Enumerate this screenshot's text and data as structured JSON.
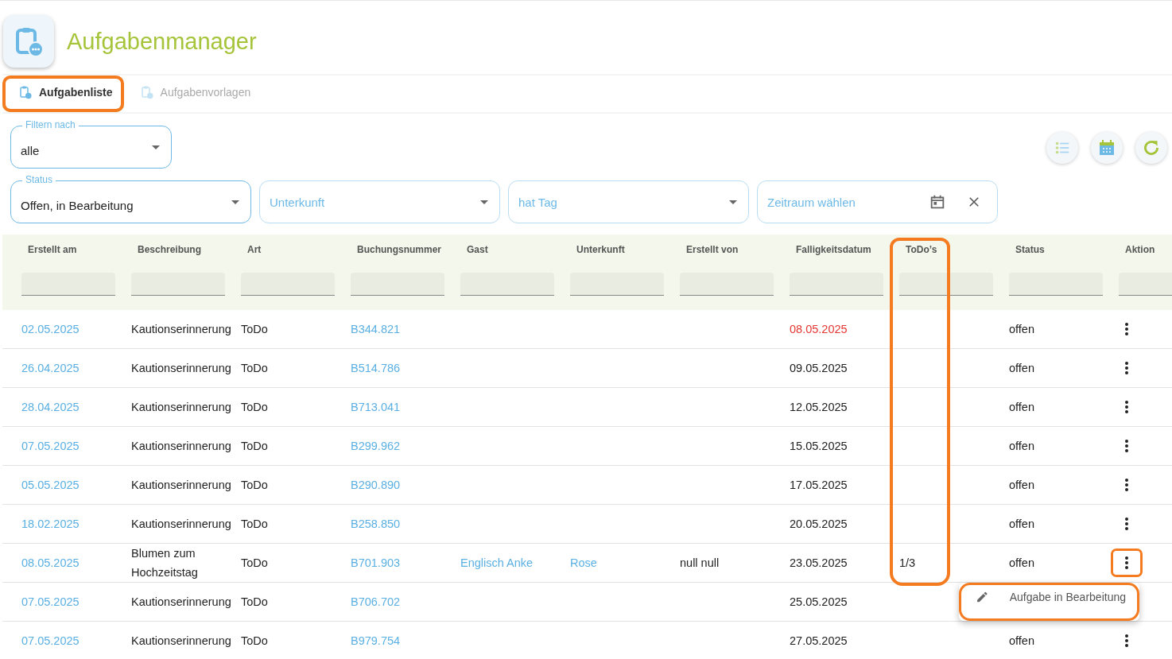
{
  "app": {
    "title": "Aufgabenmanager"
  },
  "tabs": [
    {
      "label": "Aufgabenliste",
      "selected": true,
      "highlighted": true
    },
    {
      "label": "Aufgabenvorlagen",
      "selected": false,
      "highlighted": false
    }
  ],
  "filter_by": {
    "label": "Filtern nach",
    "value": "alle"
  },
  "filters": [
    {
      "kind": "select",
      "label": "Status",
      "value": "Offen, in Bearbeitung"
    },
    {
      "kind": "select",
      "placeholder": "Unterkunft"
    },
    {
      "kind": "select",
      "placeholder": "hat Tag"
    },
    {
      "kind": "date",
      "placeholder": "Zeitraum wählen"
    }
  ],
  "table": {
    "columns": [
      "Erstellt am",
      "Beschreibung",
      "Art",
      "Buchungsnummer",
      "Gast",
      "Unterkunft",
      "Erstellt von",
      "Falligkeitsdatum",
      "ToDo’s",
      "Status",
      "Aktion"
    ],
    "rows": [
      {
        "created": "02.05.2025",
        "description": "Kautionserinnerung",
        "type": "ToDo",
        "booking": "B344.821",
        "guest": "",
        "accommodation": "",
        "created_by": "",
        "due": "08.05.2025",
        "overdue": true,
        "todos": "",
        "status": "offen",
        "action_highlighted": false
      },
      {
        "created": "26.04.2025",
        "description": "Kautionserinnerung",
        "type": "ToDo",
        "booking": "B514.786",
        "guest": "",
        "accommodation": "",
        "created_by": "",
        "due": "09.05.2025",
        "overdue": false,
        "todos": "",
        "status": "offen",
        "action_highlighted": false
      },
      {
        "created": "28.04.2025",
        "description": "Kautionserinnerung",
        "type": "ToDo",
        "booking": "B713.041",
        "guest": "",
        "accommodation": "",
        "created_by": "",
        "due": "12.05.2025",
        "overdue": false,
        "todos": "",
        "status": "offen",
        "action_highlighted": false
      },
      {
        "created": "07.05.2025",
        "description": "Kautionserinnerung",
        "type": "ToDo",
        "booking": "B299.962",
        "guest": "",
        "accommodation": "",
        "created_by": "",
        "due": "15.05.2025",
        "overdue": false,
        "todos": "",
        "status": "offen",
        "action_highlighted": false
      },
      {
        "created": "05.05.2025",
        "description": "Kautionserinnerung",
        "type": "ToDo",
        "booking": "B290.890",
        "guest": "",
        "accommodation": "",
        "created_by": "",
        "due": "17.05.2025",
        "overdue": false,
        "todos": "",
        "status": "offen",
        "action_highlighted": false
      },
      {
        "created": "18.02.2025",
        "description": "Kautionserinnerung",
        "type": "ToDo",
        "booking": "B258.850",
        "guest": "",
        "accommodation": "",
        "created_by": "",
        "due": "20.05.2025",
        "overdue": false,
        "todos": "",
        "status": "offen",
        "action_highlighted": false
      },
      {
        "created": "08.05.2025",
        "description": "Blumen zum Hochzeitstag",
        "type": "ToDo",
        "booking": "B701.903",
        "guest": "Englisch Anke",
        "accommodation": "Rose",
        "created_by": "null null",
        "due": "23.05.2025",
        "overdue": false,
        "todos": "1/3",
        "status": "offen",
        "action_highlighted": true
      },
      {
        "created": "07.05.2025",
        "description": "Kautionserinnerung",
        "type": "ToDo",
        "booking": "B706.702",
        "guest": "",
        "accommodation": "",
        "created_by": "",
        "due": "25.05.2025",
        "overdue": false,
        "todos": "",
        "status": "",
        "action_highlighted": false
      },
      {
        "created": "07.05.2025",
        "description": "Kautionserinnerung",
        "type": "ToDo",
        "booking": "B979.754",
        "guest": "",
        "accommodation": "",
        "created_by": "",
        "due": "27.05.2025",
        "overdue": false,
        "todos": "",
        "status": "offen",
        "action_highlighted": false
      }
    ]
  },
  "highlight": {
    "todos_column": true
  },
  "action_menu": {
    "open": true,
    "items": [
      {
        "label": "Aufgabe in Bearbeitung",
        "highlighted": true
      }
    ]
  }
}
